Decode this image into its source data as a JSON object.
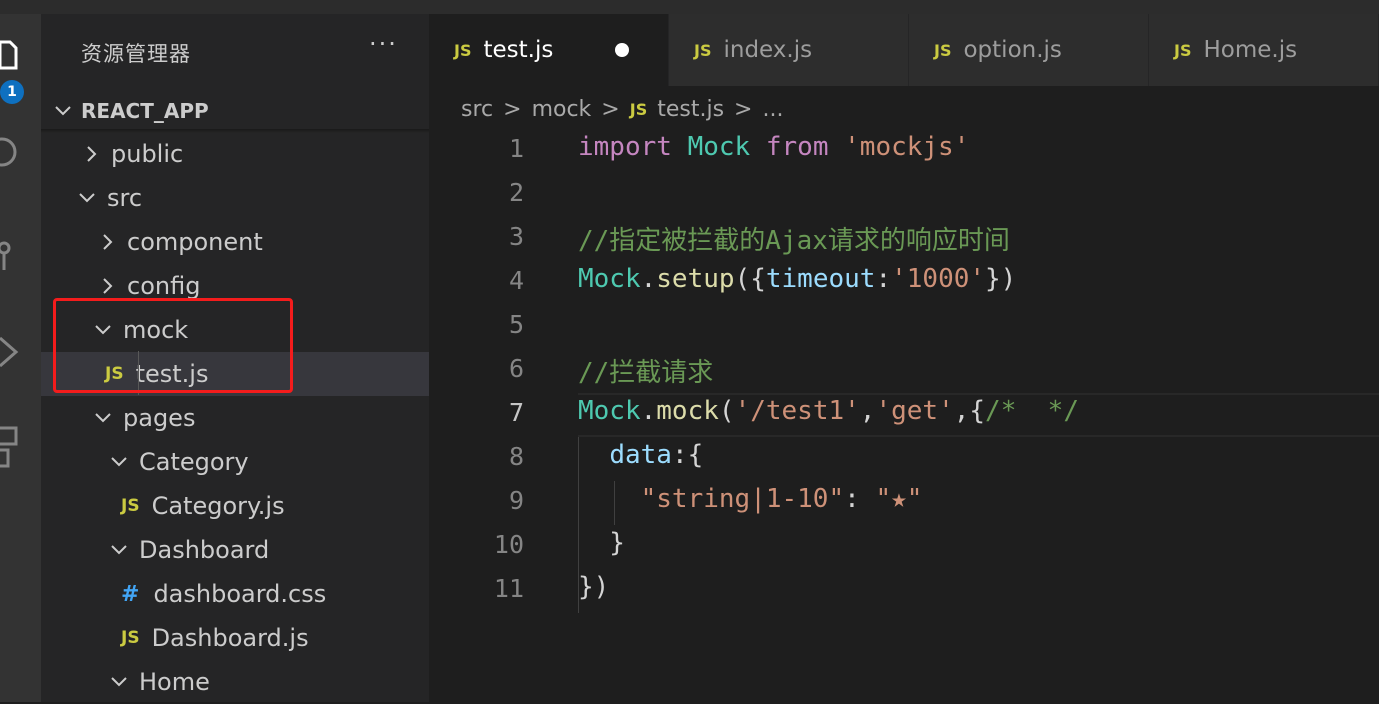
{
  "activity": {
    "badge": "1"
  },
  "sidebar": {
    "title": "资源管理器",
    "more": "···",
    "section": "REACT_APP",
    "tree": [
      {
        "label": "public",
        "type": "folder",
        "expanded": false
      },
      {
        "label": "src",
        "type": "folder",
        "expanded": true
      },
      {
        "label": "component",
        "type": "folder",
        "expanded": false
      },
      {
        "label": "config",
        "type": "folder",
        "expanded": false
      },
      {
        "label": "mock",
        "type": "folder",
        "expanded": true
      },
      {
        "label": "test.js",
        "type": "js",
        "selected": true
      },
      {
        "label": "pages",
        "type": "folder",
        "expanded": true
      },
      {
        "label": "Category",
        "type": "folder",
        "expanded": true
      },
      {
        "label": "Category.js",
        "type": "js"
      },
      {
        "label": "Dashboard",
        "type": "folder",
        "expanded": true
      },
      {
        "label": "dashboard.css",
        "type": "css"
      },
      {
        "label": "Dashboard.js",
        "type": "js"
      },
      {
        "label": "Home",
        "type": "folder",
        "expanded": true
      }
    ],
    "js_badge": "JS",
    "css_badge": "#"
  },
  "tabs": [
    {
      "label": "test.js",
      "active": true,
      "modified": true
    },
    {
      "label": "index.js"
    },
    {
      "label": "option.js"
    },
    {
      "label": "Home.js"
    }
  ],
  "breadcrumb": {
    "parts": [
      "src",
      "mock",
      "test.js",
      "..."
    ],
    "sep": ">"
  },
  "editor": {
    "current_line": 7,
    "line_numbers": [
      "1",
      "2",
      "3",
      "4",
      "5",
      "6",
      "7",
      "8",
      "9",
      "10",
      "11"
    ],
    "lines": [
      [
        [
          "kw",
          "import"
        ],
        [
          "pl",
          " "
        ],
        [
          "id",
          "Mock"
        ],
        [
          "pl",
          " "
        ],
        [
          "kw",
          "from"
        ],
        [
          "pl",
          " "
        ],
        [
          "str",
          "'mockjs'"
        ]
      ],
      [],
      [
        [
          "cm",
          "//指定被拦截的Ajax请求的响应时间"
        ]
      ],
      [
        [
          "id",
          "Mock"
        ],
        [
          "pl",
          "."
        ],
        [
          "fn",
          "setup"
        ],
        [
          "pl",
          "({"
        ],
        [
          "var",
          "timeout"
        ],
        [
          "pl",
          ":"
        ],
        [
          "str",
          "'1000'"
        ],
        [
          "pl",
          "})"
        ]
      ],
      [],
      [
        [
          "cm",
          "//拦截请求"
        ]
      ],
      [
        [
          "id",
          "Mock"
        ],
        [
          "pl",
          "."
        ],
        [
          "fn",
          "mock"
        ],
        [
          "pl",
          "("
        ],
        [
          "str",
          "'/test1'"
        ],
        [
          "pl",
          ","
        ],
        [
          "str",
          "'get'"
        ],
        [
          "pl",
          ","
        ],
        [
          "pl",
          "{"
        ],
        [
          "cm",
          "/*  */"
        ]
      ],
      [
        [
          "pl",
          "  "
        ],
        [
          "var",
          "data"
        ],
        [
          "pl",
          ":{"
        ]
      ],
      [
        [
          "pl",
          "    "
        ],
        [
          "str",
          "\"string|1-10\""
        ],
        [
          "pl",
          ": "
        ],
        [
          "str",
          "\"★\""
        ]
      ],
      [
        [
          "pl",
          "  }"
        ]
      ],
      [
        [
          "pl",
          "})"
        ]
      ]
    ]
  },
  "colors": {
    "editor_bg": "#1e1e1e",
    "sidebar_bg": "#252526",
    "highlight_box": "#f41c1c",
    "js_icon": "#cbcb41",
    "css_icon": "#42a5f5"
  }
}
